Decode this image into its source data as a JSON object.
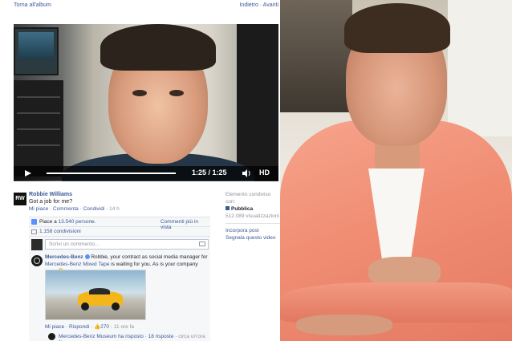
{
  "topbar": {
    "back_label": "Torna all'album",
    "nav_label": "Indietro · Avanti"
  },
  "video": {
    "current_time": "1:25",
    "duration": "1:25",
    "time_display": "1:25 / 1:25",
    "progress": 1.0,
    "hd_label": "HD"
  },
  "post": {
    "avatar_initials": "RW",
    "author": "Robbie Williams",
    "text": "Got a job for me?",
    "actions": {
      "like": "Mi piace",
      "comment": "Commenta",
      "share": "Condividi",
      "time": "14 h"
    }
  },
  "feedback": {
    "likes_prefix": "Piace a",
    "likes_count": "13.540 persone.",
    "more_comments": "Commenti più in vista",
    "shares": "1.158 condivisioni",
    "comment_placeholder": "Scrivi un commento..."
  },
  "comment": {
    "author": "Mercedes-Benz",
    "text_after_author": "Robbie, your contract as social media manager for",
    "link": "Mercedes-Benz Mixed Tape",
    "text_after_link": "is waiting for you. As is your company car...",
    "actions": {
      "like": "Mi piace",
      "reply": "Rispondi",
      "likes": "270",
      "time": "11 ore fa"
    },
    "reply": {
      "author": "Mercedes-Benz Museum",
      "verb": "ha risposto",
      "count": "18 risposte",
      "time": "circa un'ora fa"
    }
  },
  "side_info": {
    "shared_from": "Elemento condiviso con:",
    "audience": "Pubblica",
    "views": "512.089 visualizzazioni",
    "embed_link": "Incorpora post",
    "report_link": "Segnala questo video"
  },
  "colors": {
    "facebook_link": "#3b5998",
    "jacket_pink": "#f08e74",
    "control_bar": "#000000"
  }
}
